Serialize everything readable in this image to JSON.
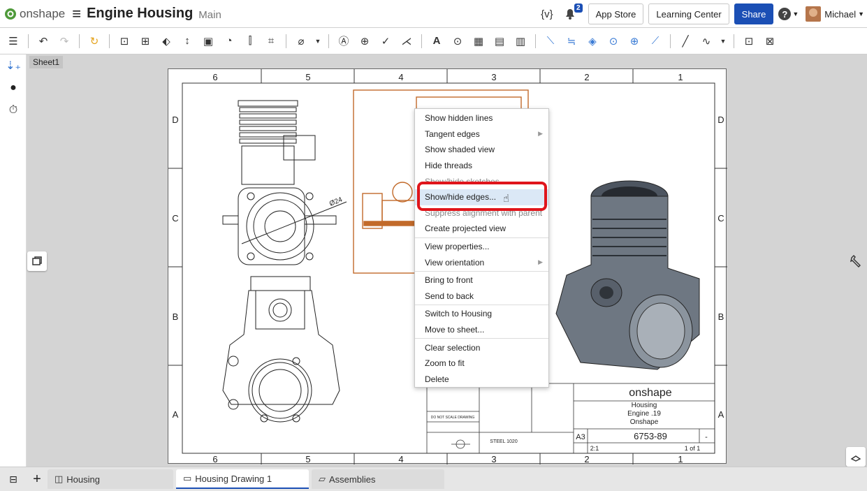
{
  "app": {
    "logo_text": "onshape",
    "title": "Engine Housing",
    "branch": "Main"
  },
  "topbar": {
    "variable_label": "{v}",
    "notification_count": "2",
    "app_store": "App Store",
    "learning_center": "Learning Center",
    "share": "Share",
    "help": "?",
    "user_name": "Michael"
  },
  "sheet_tab": "Sheet1",
  "drawing": {
    "zone_columns": [
      "6",
      "5",
      "4",
      "3",
      "2",
      "1"
    ],
    "zone_rows": [
      "D",
      "C",
      "B",
      "A"
    ],
    "dimension_label": "Ø24",
    "title_block": {
      "company": "onshape",
      "title_lines": [
        "Housing",
        "Engine .19",
        "Onshape"
      ],
      "size": "A3",
      "dwg_no": "6753-89",
      "rev": "-",
      "scale": "2:1",
      "sheet": "1 of 1",
      "material": "STEEL 1020",
      "note": "DO NOT SCALE DRAWING"
    }
  },
  "context_menu": {
    "groups": [
      [
        {
          "label": "Show hidden lines"
        },
        {
          "label": "Tangent edges",
          "submenu": true
        },
        {
          "label": "Show shaded view"
        },
        {
          "label": "Hide threads"
        },
        {
          "label": "Show/hide sketches",
          "faded": true
        },
        {
          "label": "Show/hide edges...",
          "highlighted": true
        },
        {
          "label": "Suppress alignment with parent"
        },
        {
          "label": "Create projected view"
        }
      ],
      [
        {
          "label": "View properties..."
        },
        {
          "label": "View orientation",
          "submenu": true
        }
      ],
      [
        {
          "label": "Bring to front"
        },
        {
          "label": "Send to back"
        }
      ],
      [
        {
          "label": "Switch to Housing"
        },
        {
          "label": "Move to sheet..."
        }
      ],
      [
        {
          "label": "Clear selection"
        },
        {
          "label": "Zoom to fit"
        },
        {
          "label": "Delete"
        }
      ]
    ]
  },
  "bottom_tabs": [
    {
      "label": "Housing",
      "icon": "part-studio-icon",
      "active": false
    },
    {
      "label": "Housing Drawing 1",
      "icon": "drawing-icon",
      "active": true
    },
    {
      "label": "Assemblies",
      "icon": "folder-icon",
      "active": false
    }
  ],
  "colors": {
    "accent": "#1b4fb5",
    "highlight_box": "#e0151b",
    "view_selection": "#c26a2a"
  }
}
